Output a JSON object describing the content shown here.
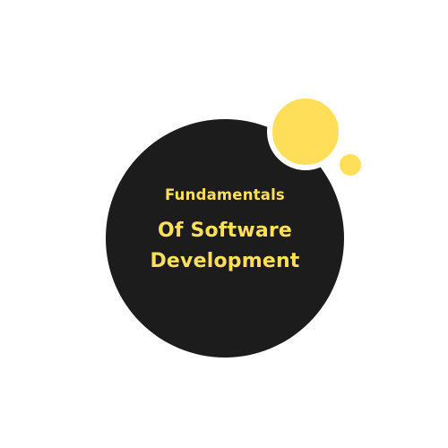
{
  "title": {
    "line1": "Fundamentals",
    "line2": "Of Software",
    "line3": "Development"
  },
  "colors": {
    "accent": "#ffde59",
    "circle": "#1c1c1c",
    "background": "#ffffff"
  }
}
